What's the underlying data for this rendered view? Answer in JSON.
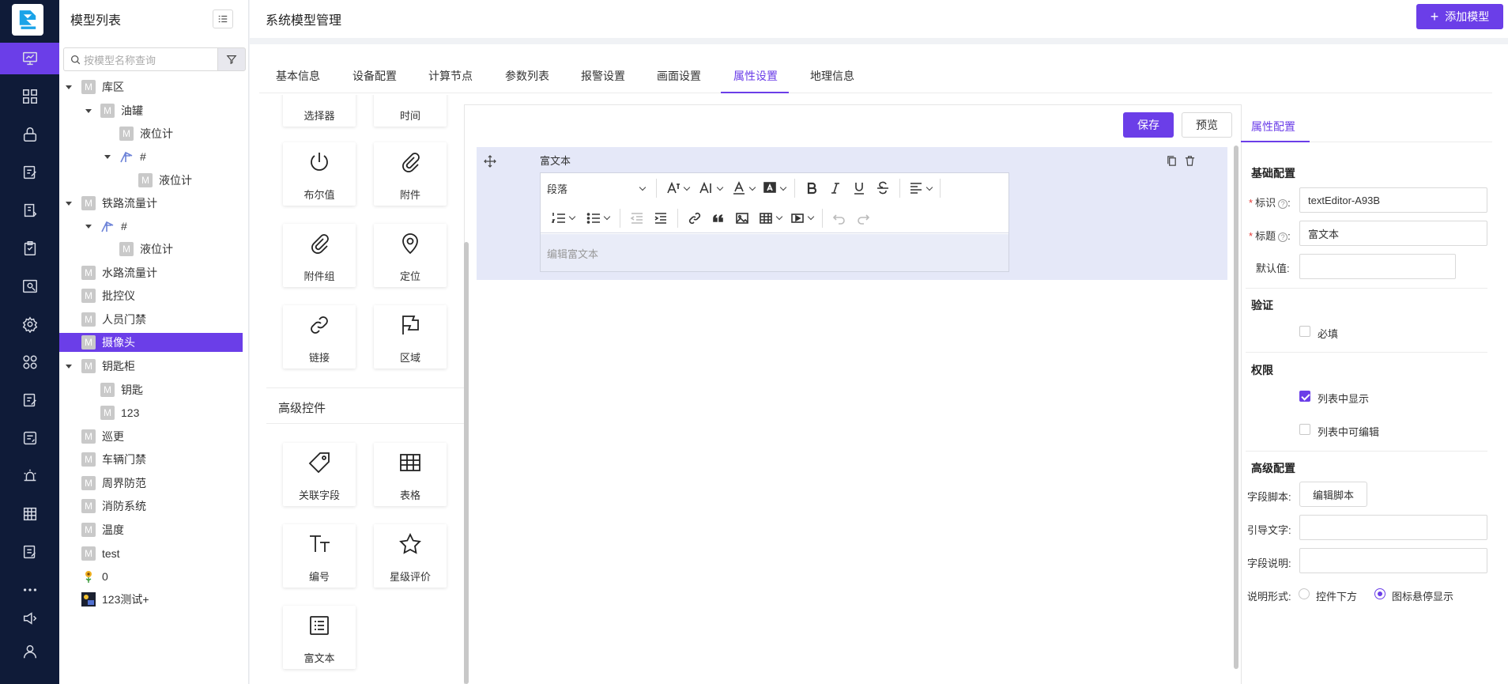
{
  "colors": {
    "accent": "#6b3ee8",
    "rail_bg": "#0f1b38",
    "block_bg": "#e5e8f8"
  },
  "rail": {
    "items": [
      "monitor-icon",
      "grid-icon",
      "lock-icon",
      "edit-icon",
      "book-icon",
      "clipboard-icon",
      "user-card-icon",
      "gear-icon",
      "apps-icon",
      "form-icon",
      "note-icon",
      "alarm-icon",
      "table-icon",
      "doc-icon",
      "more-icon",
      "speaker-icon",
      "user-icon"
    ]
  },
  "tree": {
    "title": "模型列表",
    "search_placeholder": "按模型名称查询",
    "badge": "M",
    "nodes": [
      {
        "label": "库区"
      },
      {
        "label": "油罐"
      },
      {
        "label": "液位计"
      },
      {
        "label": "#"
      },
      {
        "label": "液位计"
      },
      {
        "label": "铁路流量计"
      },
      {
        "label": "#"
      },
      {
        "label": "液位计"
      },
      {
        "label": "水路流量计"
      },
      {
        "label": "批控仪"
      },
      {
        "label": "人员门禁"
      },
      {
        "label": "摄像头"
      },
      {
        "label": "钥匙柜"
      },
      {
        "label": "钥匙"
      },
      {
        "label": "123"
      },
      {
        "label": "巡更"
      },
      {
        "label": "车辆门禁"
      },
      {
        "label": "周界防范"
      },
      {
        "label": "消防系统"
      },
      {
        "label": "温度"
      },
      {
        "label": "test"
      },
      {
        "label": "0"
      },
      {
        "label": "123测试+"
      }
    ]
  },
  "header": {
    "title": "系统模型管理",
    "add_button": "添加模型",
    "add_symbol": "+"
  },
  "tabs": [
    "基本信息",
    "设备配置",
    "计算节点",
    "参数列表",
    "报警设置",
    "画面设置",
    "属性设置",
    "地理信息"
  ],
  "active_tab": "属性设置",
  "palette": {
    "top_partial": [
      "选择器",
      "时间"
    ],
    "basic": [
      "布尔值",
      "附件",
      "附件组",
      "定位",
      "链接",
      "区域"
    ],
    "advanced_title": "高级控件",
    "advanced": [
      "关联字段",
      "表格",
      "编号",
      "星级评价",
      "富文本"
    ]
  },
  "canvas": {
    "save": "保存",
    "preview": "预览",
    "field_label": "富文本",
    "paragraph": "段落",
    "editor_placeholder": "编辑富文本"
  },
  "props": {
    "tab": "属性配置",
    "basic_title": "基础配置",
    "id_label": "标识",
    "id_value": "textEditor-A93B",
    "title_label": "标题",
    "title_value": "富文本",
    "default_label": "默认值:",
    "validate_title": "验证",
    "required": "必填",
    "perm_title": "权限",
    "show_in_list": "列表中显示",
    "show_in_list_checked": true,
    "editable_in_list": "列表中可编辑",
    "editable_in_list_checked": false,
    "adv_title": "高级配置",
    "script_label": "字段脚本:",
    "script_button": "编辑脚本",
    "guide_label": "引导文字:",
    "desc_label": "字段说明:",
    "desc_mode_label": "说明形式:",
    "mode_below": "控件下方",
    "mode_hover": "图标悬停显示",
    "mode_selected": "图标悬停显示"
  }
}
